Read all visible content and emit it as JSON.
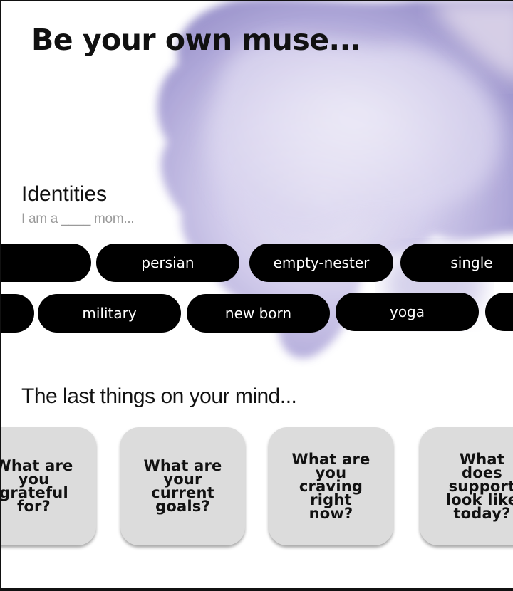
{
  "header": {
    "title": "Be your own muse..."
  },
  "identities": {
    "title": "Identities",
    "subtitle": "I am a ____ mom...",
    "row1": [
      "",
      "persian",
      "empty-nester",
      "single"
    ],
    "row2": [
      "",
      "military",
      "new born",
      "yoga",
      ""
    ]
  },
  "mind": {
    "title": "The last things on your mind...",
    "cards": [
      "What are\nyou\ngrateful\nfor?",
      "What are\nyour\ncurrent\ngoals?",
      "What are\nyou\ncraving\nright\nnow?",
      "What\ndoes\nsupport\nlook like\ntoday?"
    ]
  },
  "colors": {
    "pill_bg": "#000000",
    "card_bg": "#dcdcdc",
    "accent_wash": "#8f86c8"
  }
}
